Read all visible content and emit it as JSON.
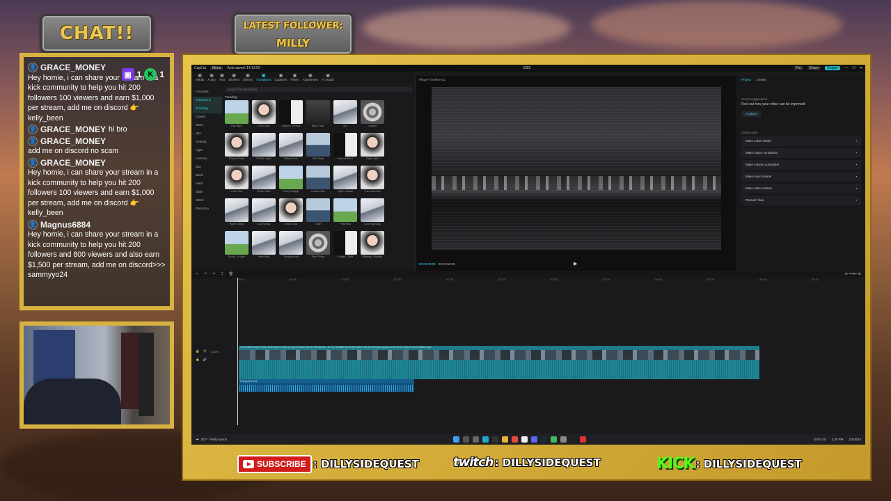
{
  "overlay": {
    "chat_title": "CHAT!!",
    "latest_follower_label": "LATEST FOLLOWER:",
    "latest_follower_name": "MILLY",
    "counters": {
      "twitch": "1",
      "kick": "1"
    }
  },
  "chat": [
    {
      "user": "GRACE_MONEY",
      "inline": "",
      "text": "Hey homie, i can share your stream in a kick community to help you hit 200 followers 100 viewers and earn $1,000 per stream, add me on discord 👉 kelly_been"
    },
    {
      "user": "GRACE_MONEY",
      "inline": "hi bro",
      "text": ""
    },
    {
      "user": "GRACE_MONEY",
      "inline": "",
      "text": "add me on discord no scam"
    },
    {
      "user": "GRACE_MONEY",
      "inline": "",
      "text": "Hey homie, i can share your stream in a kick community to help you hit 200 followers 100 viewers and earn $1,000 per stream, add me on discord 👉 kelly_been"
    },
    {
      "user": "Magnus6884",
      "inline": "",
      "text": "Hey homie, i can share your stream in a kick community to help you hit 200 followers and 800 viewers and also earn $1,500 per stream, add me on discord>>> sammyyo24"
    }
  ],
  "editor": {
    "app_name": "CapCut",
    "menu": "Menu",
    "autosave": "Auto saved: 14:13:02",
    "project_title": "0302",
    "pro": "Pro",
    "share": "Share",
    "export": "Export",
    "tools": [
      "Media",
      "Audio",
      "Text",
      "Stickers",
      "Effects",
      "Transitions",
      "Captions",
      "Filters",
      "Adjustment",
      "AI avatar"
    ],
    "active_tool": "Transitions",
    "nav": [
      "Favorites",
      "Transitions",
      "Trending",
      "Classic",
      "NEW",
      "Hits",
      "Overlay",
      "Light",
      "Camera",
      "Blur",
      "Basic",
      "Mask",
      "Slide",
      "Glitch",
      "Distortion"
    ],
    "search_placeholder": "Search for transitions",
    "section": "Trending",
    "thumbs": [
      {
        "cap": "Flip Right",
        "kind": "field"
      },
      {
        "cap": "Film Erase",
        "kind": "face"
      },
      {
        "cap": "Camera_Vertical",
        "kind": "bw"
      },
      {
        "cap": "Black Fade",
        "kind": "dark"
      },
      {
        "cap": "Mix",
        "kind": "mtn"
      },
      {
        "cap": "Lateral",
        "kind": "swirl"
      },
      {
        "cap": "Photon Portal",
        "kind": "face"
      },
      {
        "cap": "3D Rot...ation",
        "kind": "mtn"
      },
      {
        "cap": "Willow Fade",
        "kind": "mtn"
      },
      {
        "cap": "360 Swipe",
        "kind": "sea"
      },
      {
        "cap": "Vertical Blur II",
        "kind": "bw"
      },
      {
        "cap": "Slight Jitter",
        "kind": "face"
      },
      {
        "cap": "Lover Tear",
        "kind": "face"
      },
      {
        "cap": "White Flash",
        "kind": "mtn"
      },
      {
        "cap": "Fuzzy Pagefip",
        "kind": "field"
      },
      {
        "cap": "Unseen Blur",
        "kind": "sea"
      },
      {
        "cap": "Lighti...ebeam",
        "kind": "mtn"
      },
      {
        "cap": "Then and Now",
        "kind": "face"
      },
      {
        "cap": "Paper Unfold",
        "kind": "mtn"
      },
      {
        "cap": "Love Decay",
        "kind": "mtn"
      },
      {
        "cap": "Ghost Glow",
        "kind": "face"
      },
      {
        "cap": "Chile",
        "kind": "sea"
      },
      {
        "cap": "Pink Bled",
        "kind": "field"
      },
      {
        "cap": "Love Hypnosis",
        "kind": "mtn"
      },
      {
        "cap": "Distort...d Wipe",
        "kind": "field"
      },
      {
        "cap": "Heart Pop",
        "kind": "mtn"
      },
      {
        "cap": "Turning Heart",
        "kind": "mtn"
      },
      {
        "cap": "Pink Flicker",
        "kind": "swirl"
      },
      {
        "cap": "Foliage...Slide",
        "kind": "bw"
      },
      {
        "cap": "Bittersw...Wonder",
        "kind": "face"
      }
    ],
    "player_title": "Player-Timeline 01",
    "time_current": "00:00:00:00",
    "time_total": "00:04:58:00",
    "right_tabs": [
      "Project",
      "Details"
    ],
    "smart_label": "Smart suggestions",
    "smart_sub": "Find out how your video can be improved",
    "analyse": "Analyse",
    "global_label": "Global edits",
    "global_items": [
      "Make colors better",
      "Make colors consistent",
      "Make volume consistent",
      "Make voice clearer",
      "Make video clearer",
      "Retouch face"
    ],
    "ruler": [
      "00:00",
      "00:30",
      "01:00",
      "01:30",
      "02:00",
      "02:30",
      "03:00",
      "03:30",
      "04:00",
      "04:30",
      "05:00",
      "05:30"
    ],
    "cover": "Cover",
    "clip_labels": "0176 25ffeb.mp4  00:00:12:02  Speed 1.6X  Sp  Speed  Speed  0176 2d8  Speed 1.6X  0176 25ffeb  0176 2bf  Speed  0176 2bf  Speed  Speed 3.3X  0176 2  Speed  0176 25ffeb.mp4",
    "audio_label": "Pangelat Funk",
    "taskbar": {
      "weather_temp": "34°F",
      "weather_desc": "Partly sunny",
      "lang": "ENG US",
      "time": "2:30 PM",
      "date": "2/3/2024"
    }
  },
  "socials": {
    "yt_label": "SUBSCRIBE",
    "yt_handle": ": DILLYSIDEQUEST",
    "twitch_word": "twitch",
    "twitch_handle": ": DILLYSIDEQUEST",
    "kick_word": "KICK",
    "kick_handle": ": DILLYSIDEQUEST"
  }
}
